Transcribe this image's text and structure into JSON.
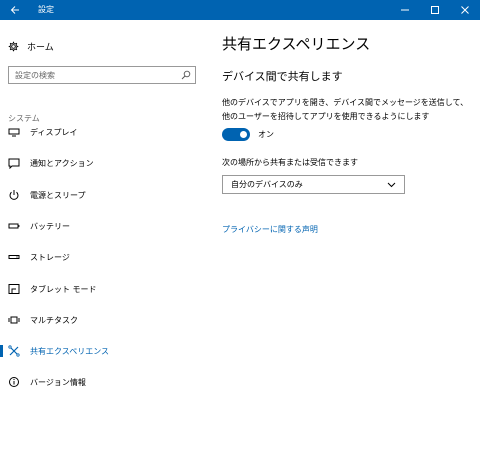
{
  "window": {
    "title": "設定"
  },
  "sidebar": {
    "home_label": "ホーム",
    "search_placeholder": "設定の検索",
    "section_label": "システム",
    "items": [
      {
        "label": "ディスプレイ",
        "icon": "display-icon"
      },
      {
        "label": "通知とアクション",
        "icon": "notification-icon"
      },
      {
        "label": "電源とスリープ",
        "icon": "power-icon"
      },
      {
        "label": "バッテリー",
        "icon": "battery-icon"
      },
      {
        "label": "ストレージ",
        "icon": "storage-icon"
      },
      {
        "label": "タブレット モード",
        "icon": "tablet-mode-icon"
      },
      {
        "label": "マルチタスク",
        "icon": "multitask-icon"
      },
      {
        "label": "共有エクスペリエンス",
        "icon": "shared-experience-icon",
        "active": true
      },
      {
        "label": "バージョン情報",
        "icon": "info-icon"
      }
    ]
  },
  "main": {
    "title": "共有エクスペリエンス",
    "subheading": "デバイス間で共有します",
    "description": "他のデバイスでアプリを開き、デバイス間でメッセージを送信して、他のユーザーを招待してアプリを使用できるようにします",
    "toggle": {
      "state": "on",
      "label": "オン"
    },
    "receive_label": "次の場所から共有または受信できます",
    "select_value": "自分のデバイスのみ",
    "privacy_link": "プライバシーに関する声明"
  },
  "colors": {
    "accent": "#0063b1",
    "titlebar": "#0063b1"
  }
}
